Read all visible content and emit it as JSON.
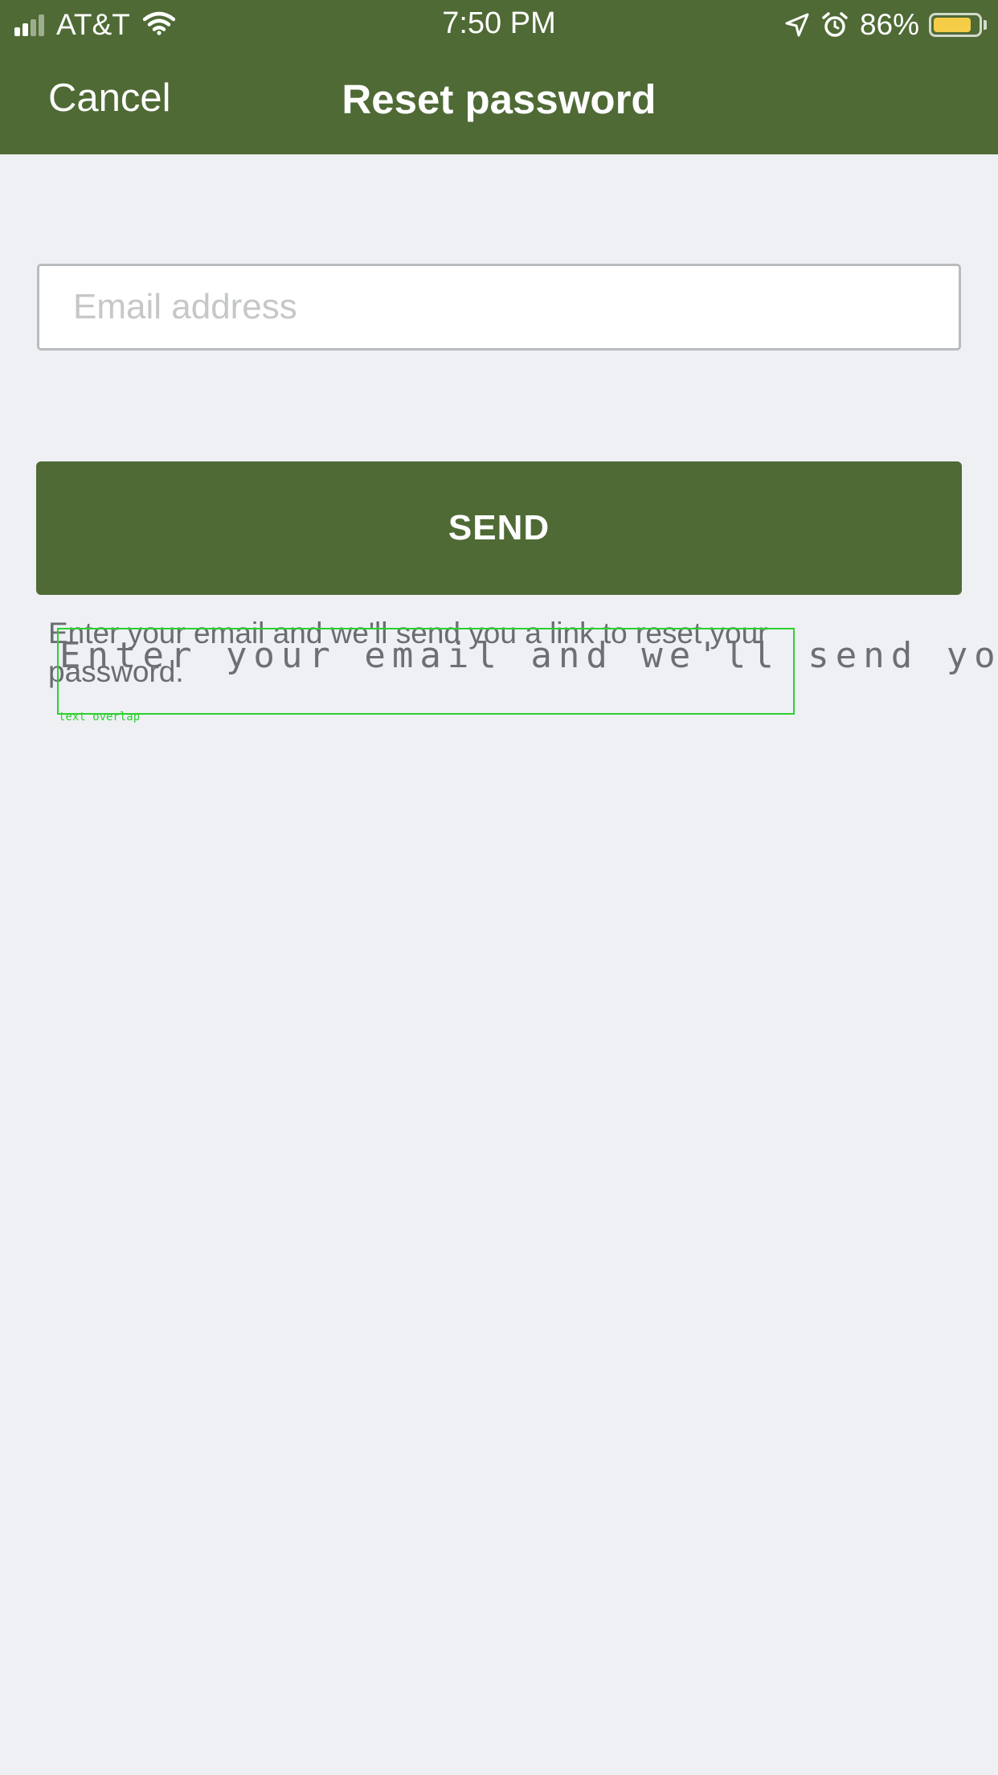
{
  "status_bar": {
    "carrier": "AT&T",
    "time": "7:50 PM",
    "battery_percent": "86%",
    "battery_level": 0.86,
    "icons": [
      "signal-icon",
      "wifi-icon",
      "location-arrow-icon",
      "alarm-icon",
      "battery-icon"
    ]
  },
  "nav": {
    "cancel_label": "Cancel",
    "title": "Reset password"
  },
  "form": {
    "email_placeholder": "Email address",
    "email_value": "",
    "send_label": "SEND",
    "help_text": "Enter your email and we'll send you a link to reset your password."
  },
  "overlay": {
    "text": "Enter your email and we'll send you a link to",
    "label": "text overlap"
  },
  "colors": {
    "brand_green": "#4f6a35",
    "background": "#eef0f4",
    "battery_fill": "#f5cd47",
    "overlay_box": "#2ed02e"
  }
}
